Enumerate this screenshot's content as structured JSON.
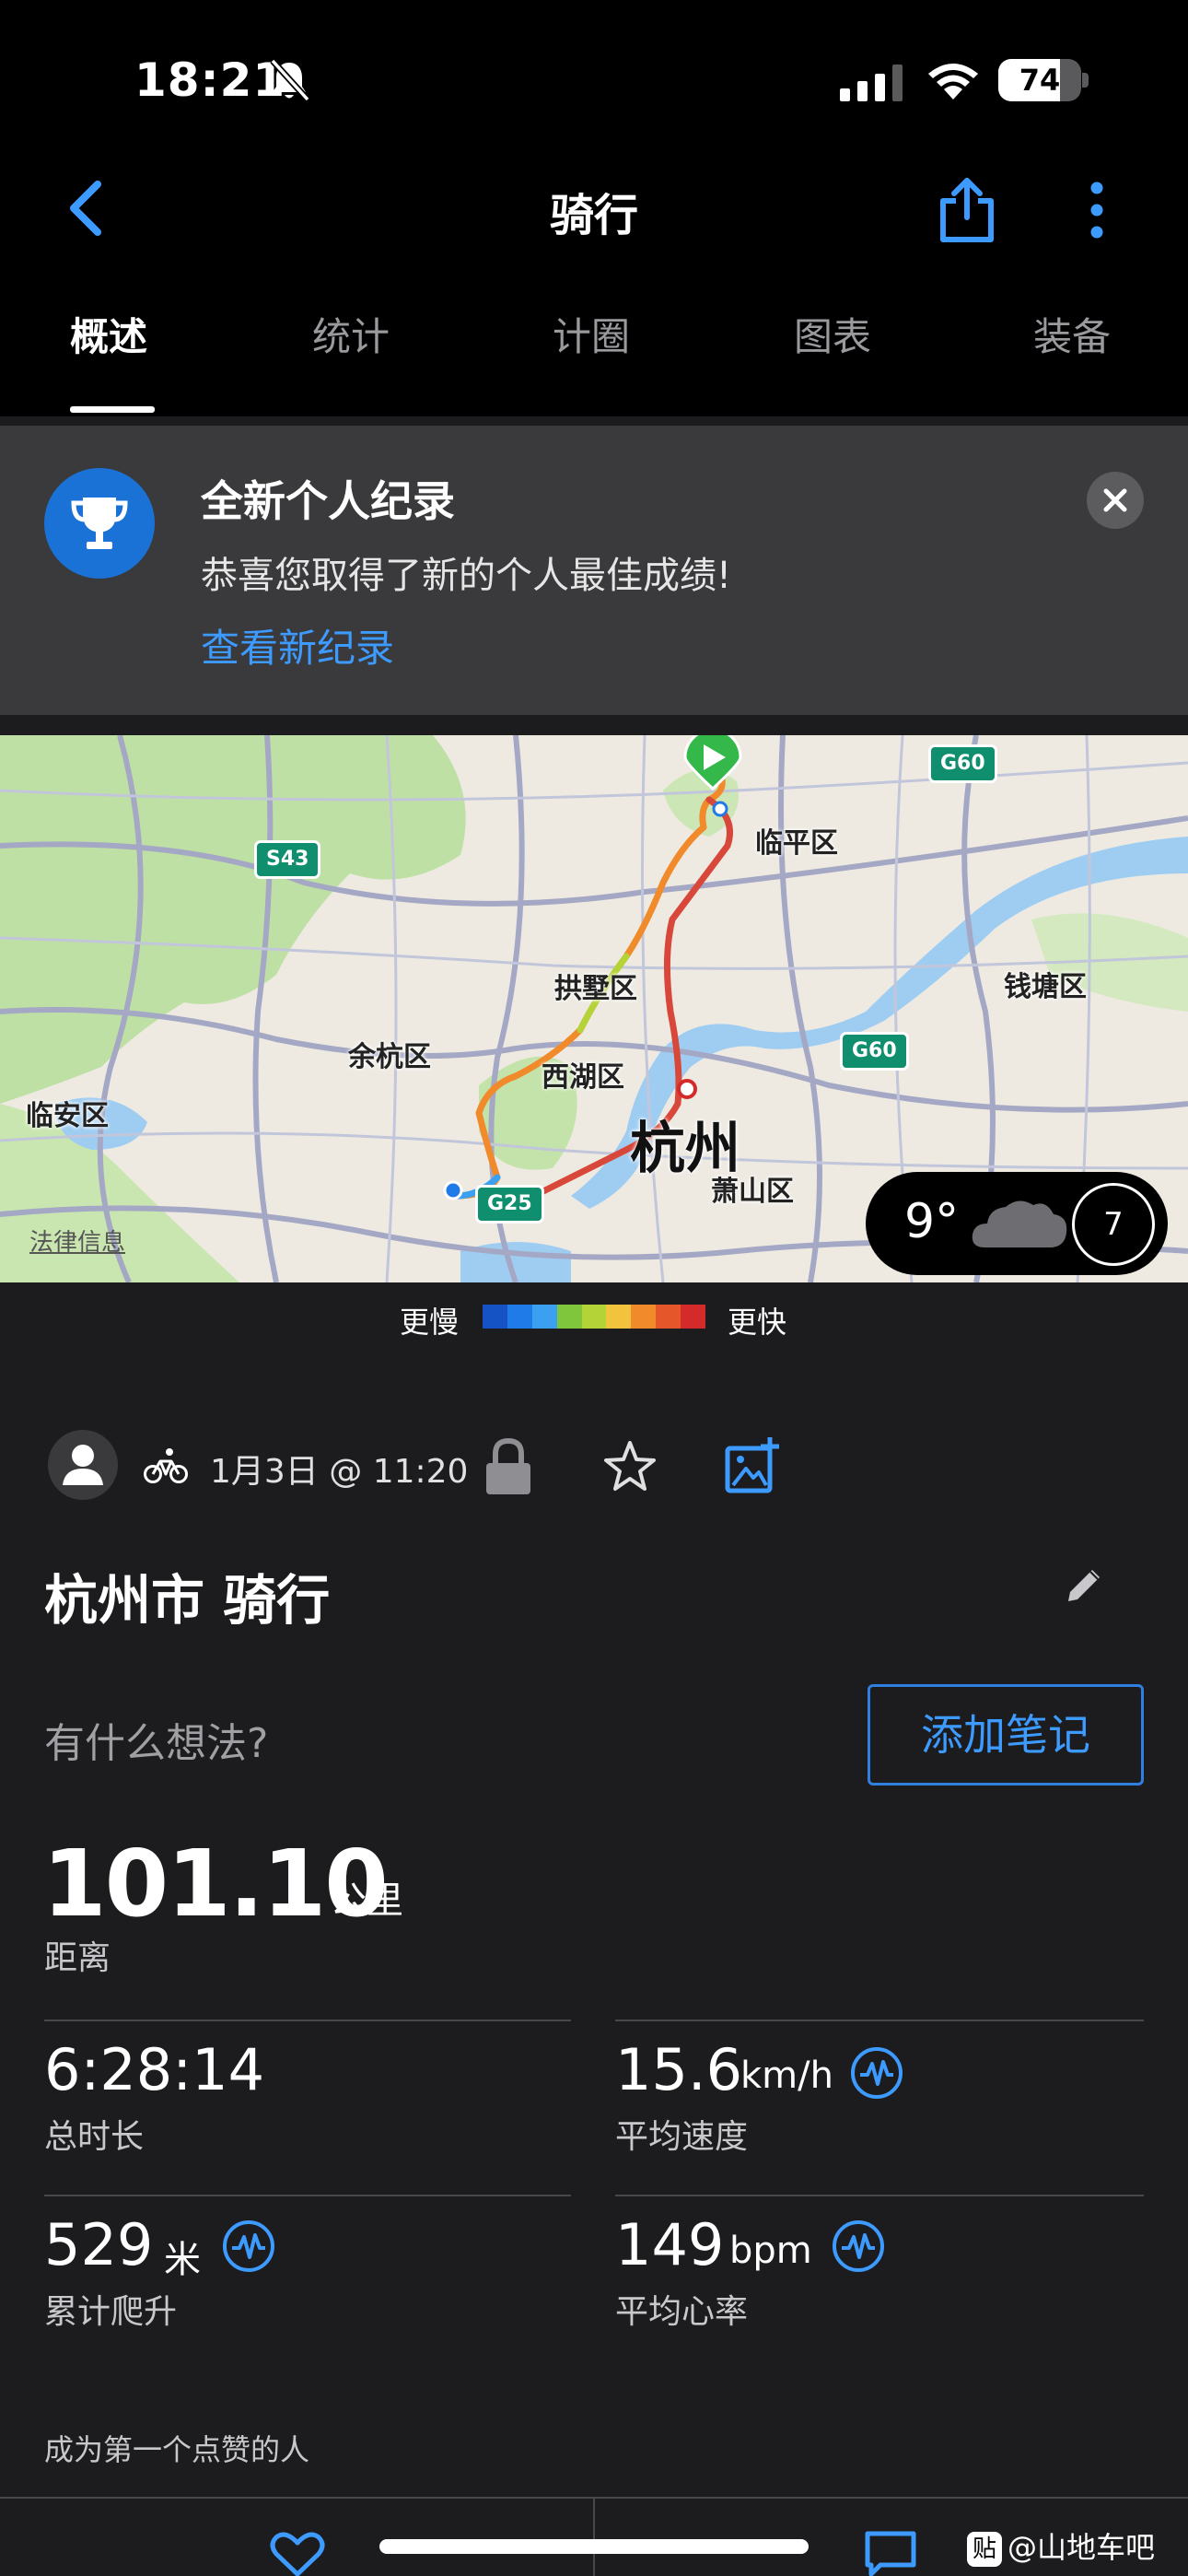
{
  "status_bar": {
    "time": "18:21",
    "battery": "74",
    "battery_level": 0.74
  },
  "header": {
    "title": "骑行"
  },
  "tabs": [
    {
      "label": "概述"
    },
    {
      "label": "统计"
    },
    {
      "label": "计圈"
    },
    {
      "label": "图表"
    },
    {
      "label": "装备"
    }
  ],
  "banner": {
    "title": "全新个人纪录",
    "text": "恭喜您取得了新的个人最佳成绩!",
    "link": "查看新纪录"
  },
  "map": {
    "labels": {
      "linping": "临平区",
      "gongshu": "拱墅区",
      "qiantang": "钱塘区",
      "yuhang": "余杭区",
      "xihu": "西湖区",
      "linan": "临安区",
      "hangzhou": "杭州",
      "xiaoshan": "萧山区"
    },
    "highways": {
      "g60_top": "G60",
      "s43": "S43",
      "g60_mid": "G60",
      "g25": "G25"
    },
    "legal": "法律信息",
    "weather": {
      "temp": "9°",
      "wind": "7"
    }
  },
  "legend": {
    "slow": "更慢",
    "fast": "更快",
    "colors": [
      "#1552c4",
      "#1e7be8",
      "#3aa0ef",
      "#7fc63c",
      "#b4d336",
      "#f2c33c",
      "#f08a2a",
      "#e5562a",
      "#d42a2a"
    ]
  },
  "activity": {
    "date": "1月3日 @ 11:20",
    "title": "杭州市 骑行",
    "thoughts_prompt": "有什么想法?",
    "add_note": "添加笔记",
    "distance": {
      "value": "101.10",
      "unit": "公里",
      "label": "距离"
    },
    "duration": {
      "value": "6:28:14",
      "label": "总时长"
    },
    "avg_speed": {
      "value": "15.6",
      "unit": "km/h",
      "label": "平均速度"
    },
    "ascent": {
      "value": "529",
      "unit": "米",
      "label": "累计爬升"
    },
    "avg_hr": {
      "value": "149",
      "unit": "bpm",
      "label": "平均心率"
    },
    "like_prompt": "成为第一个点赞的人"
  },
  "watermark": {
    "icon": "贴",
    "text": "@山地车吧"
  },
  "colors": {
    "accent": "#3d9bff",
    "background": "#1c1c1e",
    "banner": "#3a3a3c"
  }
}
